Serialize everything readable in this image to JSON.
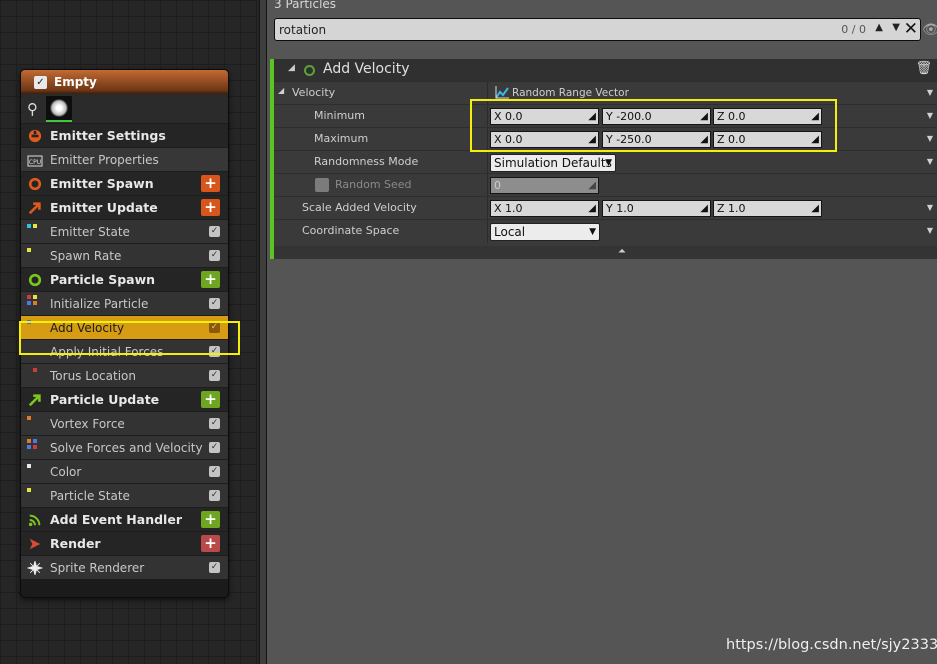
{
  "node": {
    "title": "Empty",
    "rows": [
      {
        "label": "Emitter Settings",
        "kind": "section",
        "icon": "emitter-settings-icon"
      },
      {
        "label": "Emitter Properties",
        "kind": "sub",
        "icon": "cpu-icon"
      },
      {
        "label": "Emitter Spawn",
        "kind": "section",
        "icon": "emitter-spawn-icon",
        "add": "orange"
      },
      {
        "label": "Emitter Update",
        "kind": "section",
        "icon": "emitter-update-icon",
        "add": "orange"
      },
      {
        "label": "Emitter State",
        "kind": "item",
        "checked": true
      },
      {
        "label": "Spawn Rate",
        "kind": "item",
        "checked": true
      },
      {
        "label": "Particle Spawn",
        "kind": "section",
        "icon": "particle-spawn-icon",
        "add": "green"
      },
      {
        "label": "Initialize Particle",
        "kind": "item",
        "checked": true
      },
      {
        "label": "Add Velocity",
        "kind": "item",
        "checked": true,
        "selected": true
      },
      {
        "label": "Apply Initial Forces",
        "kind": "item",
        "checked": true
      },
      {
        "label": "Torus Location",
        "kind": "item",
        "checked": true
      },
      {
        "label": "Particle Update",
        "kind": "section",
        "icon": "particle-update-icon",
        "add": "green"
      },
      {
        "label": "Vortex Force",
        "kind": "item",
        "checked": true
      },
      {
        "label": "Solve Forces and Velocity",
        "kind": "item",
        "checked": true
      },
      {
        "label": "Color",
        "kind": "item",
        "checked": true
      },
      {
        "label": "Particle State",
        "kind": "item",
        "checked": true
      },
      {
        "label": "Add Event Handler",
        "kind": "section",
        "icon": "event-handler-icon",
        "add": "green"
      },
      {
        "label": "Render",
        "kind": "section",
        "icon": "render-icon",
        "add": "red"
      },
      {
        "label": "Sprite Renderer",
        "kind": "item",
        "icon": "sprite-icon",
        "checked": true
      }
    ]
  },
  "panel": {
    "particles_count": "3 Particles",
    "search": {
      "value": "rotation",
      "match_count": "0 / 0"
    },
    "module_title": "Add Velocity",
    "velocity": {
      "label": "Velocity",
      "mode": "Random Range Vector"
    },
    "minimum": {
      "label": "Minimum",
      "x": "X 0.0",
      "y": "Y -200.0",
      "z": "Z 0.0"
    },
    "maximum": {
      "label": "Maximum",
      "x": "X 0.0",
      "y": "Y -250.0",
      "z": "Z 0.0"
    },
    "randomness_mode": {
      "label": "Randomness Mode",
      "value": "Simulation Defaults"
    },
    "random_seed": {
      "label": "Random Seed",
      "value": "0"
    },
    "scale_added_velocity": {
      "label": "Scale Added Velocity",
      "x": "X 1.0",
      "y": "Y 1.0",
      "z": "Z 1.0"
    },
    "coordinate_space": {
      "label": "Coordinate Space",
      "value": "Local"
    }
  },
  "watermark": "https://blog.csdn.net/sjy2333",
  "colors": {
    "accent_green": "#5ac51e",
    "highlight_yellow": "#f3ee0a",
    "selected_row": "#d69c14"
  }
}
